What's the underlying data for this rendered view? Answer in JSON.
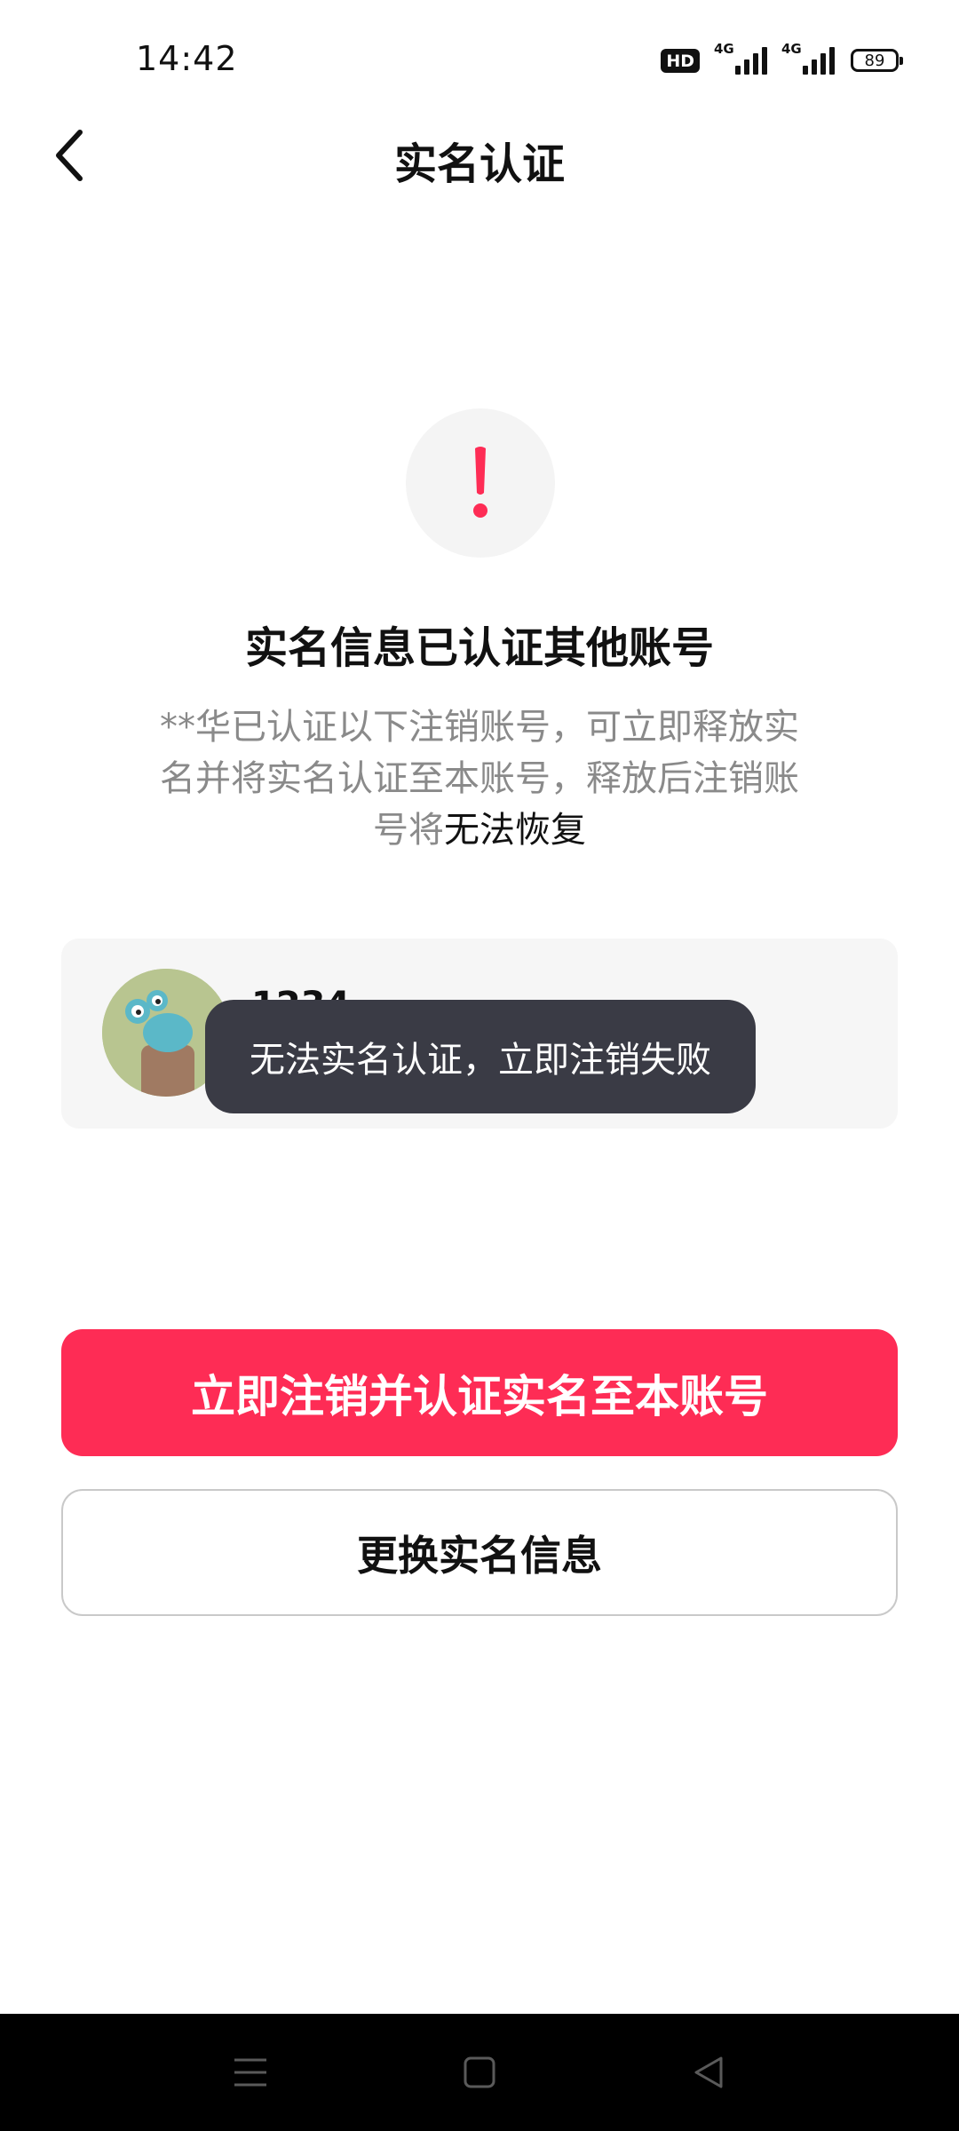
{
  "status_bar": {
    "time": "14:42",
    "hd_label": "HD",
    "signal1_label": "4G",
    "signal2_label": "4G",
    "battery": "89"
  },
  "header": {
    "title": "实名认证",
    "back_icon": "chevron-left-icon"
  },
  "alert": {
    "icon": "exclamation-icon",
    "color": "#fe2c55",
    "headline": "实名信息已认证其他账号",
    "description_prefix": "**华已认证以下注销账号，可立即释放实名并将实名认证至本账号，释放后注销账号将",
    "description_emphasis": "无法恢复"
  },
  "account": {
    "name": "1234"
  },
  "toast": {
    "message": "无法实名认证，立即注销失败"
  },
  "actions": {
    "primary_label": "立即注销并认证实名至本账号",
    "secondary_label": "更换实名信息",
    "primary_color": "#fe2c55"
  },
  "nav_bar": {
    "menu_icon": "menu-icon",
    "home_icon": "home-icon",
    "back_icon": "back-triangle-icon"
  }
}
